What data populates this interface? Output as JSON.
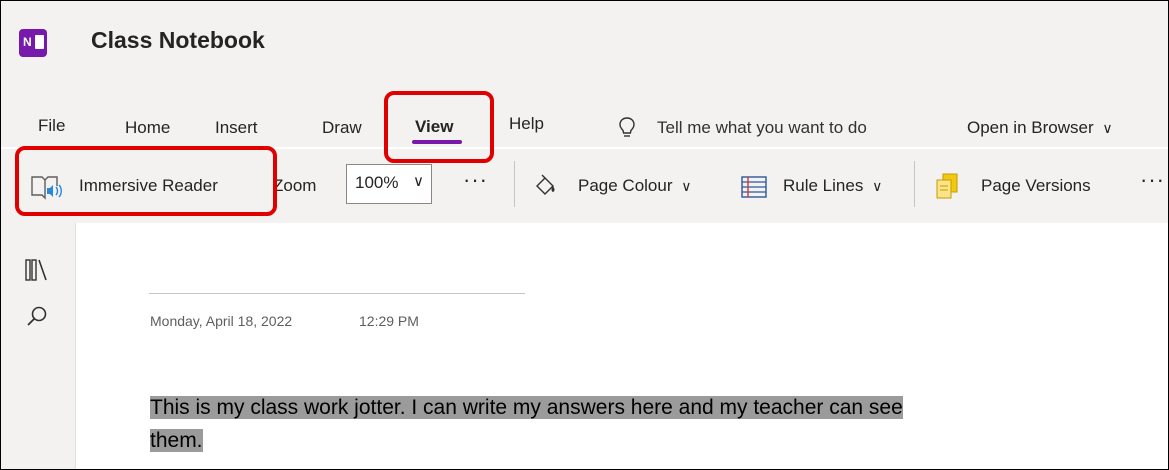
{
  "app": {
    "title": "Class Notebook",
    "logo_letters": "N"
  },
  "ribbon": {
    "tabs": [
      {
        "label": "File"
      },
      {
        "label": "Home"
      },
      {
        "label": "Insert"
      },
      {
        "label": "Draw"
      },
      {
        "label": "View",
        "active": true
      },
      {
        "label": "Help"
      }
    ],
    "tell_me": "Tell me what you want to do",
    "open_in_browser": "Open in Browser"
  },
  "toolbar": {
    "immersive_reader": "Immersive Reader",
    "zoom_label": "Zoom",
    "zoom_value": "100%",
    "more": "···",
    "page_colour": "Page Colour",
    "rule_lines": "Rule Lines",
    "page_versions": "Page Versions",
    "overflow": "···"
  },
  "page": {
    "date": "Monday, April 18, 2022",
    "time": "12:29 PM",
    "line1": "This is my class work jotter. I can write my answers here and my teacher can see",
    "line2": "them."
  },
  "colors": {
    "accent": "#7719aa",
    "callout": "#e00000",
    "highlight": "#9b9b9b"
  }
}
